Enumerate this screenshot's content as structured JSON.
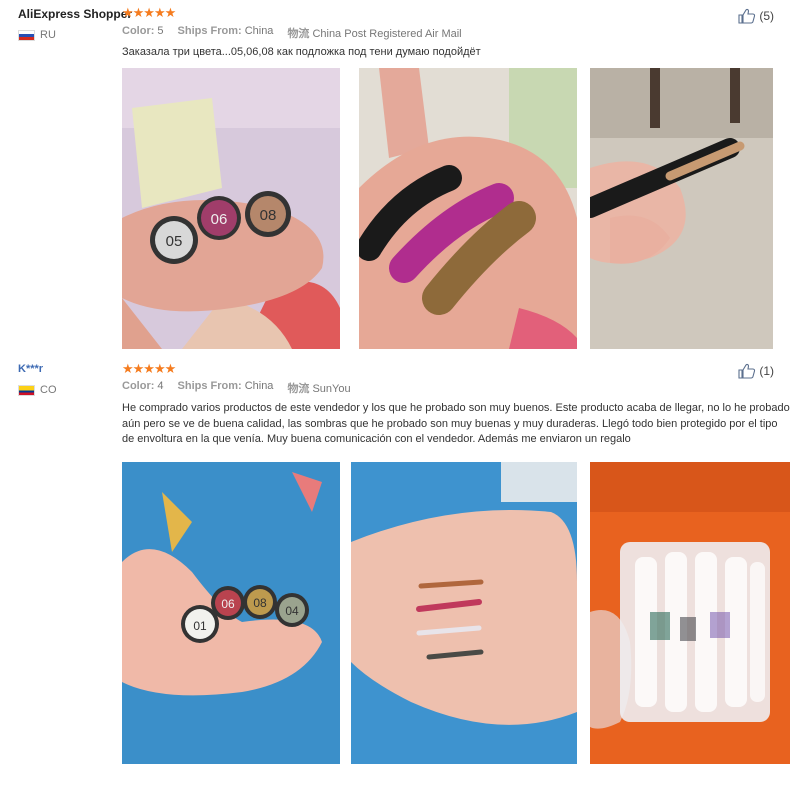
{
  "reviews": [
    {
      "user": "AliExpress Shopper",
      "country_code": "RU",
      "stars": "★★★★★",
      "color_label": "Color:",
      "color_value": "5",
      "ships_label": "Ships From:",
      "ships_value": "China",
      "logistics_label": "物流",
      "logistics_value": "China Post Registered Air Mail",
      "helpful_count": "(5)",
      "text": "Заказала три цвета...05,06,08 как подложка под тени думаю подойдёт",
      "photos": [
        {
          "caps": [
            "05",
            "06",
            "08"
          ]
        },
        {},
        {}
      ]
    },
    {
      "user": "K***r",
      "country_code": "CO",
      "stars": "★★★★★",
      "color_label": "Color:",
      "color_value": "4",
      "ships_label": "Ships From:",
      "ships_value": "China",
      "logistics_label": "物流",
      "logistics_value": "SunYou",
      "helpful_count": "(1)",
      "text": "He comprado varios productos de este vendedor y los que he probado son muy buenos. Este producto acaba de llegar, no lo he probado aún pero se ve de buena calidad, las sombras que he probado son muy buenas y muy duraderas. Llegó todo bien protegido por el tipo de envoltura en la que venía. Muy buena comunicación con el vendedor. Además me enviaron un regalo",
      "photos": [
        {
          "caps": [
            "01",
            "06",
            "08",
            "04"
          ]
        },
        {},
        {}
      ]
    }
  ],
  "colors": {
    "star": "#f57c1f",
    "user_link": "#3d6ab3"
  }
}
